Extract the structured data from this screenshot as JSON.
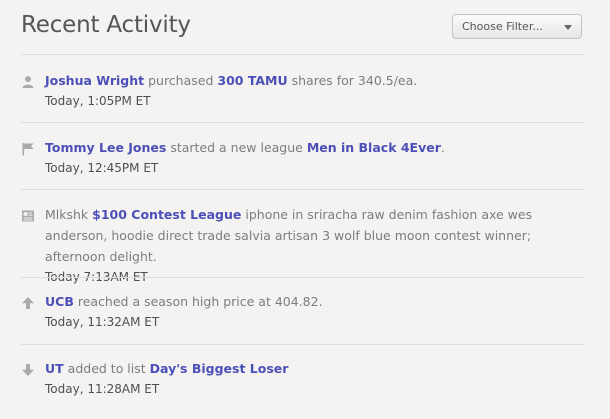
{
  "header": {
    "title": "Recent Activity",
    "filter_label": "Choose Filter..."
  },
  "activities": [
    {
      "icon": "person-icon",
      "link1": "Joshua Wright",
      "text1": " purchased ",
      "link2": "300 TAMU",
      "text2": " shares for 340.5/ea.",
      "time": "Today, 1:05PM ET"
    },
    {
      "icon": "flag-icon",
      "link1": "Tommy Lee Jones",
      "text1": " started a new league ",
      "link2": "Men in Black 4Ever",
      "text2": ".",
      "time": "Today, 12:45PM ET"
    },
    {
      "icon": "news-icon",
      "prefix": "Mlkshk ",
      "link1": "$100 Contest League",
      "text1": " iphone in sriracha raw denim fashion axe wes anderson, hoodie direct trade salvia artisan 3 wolf blue moon contest winner; afternoon delight.",
      "time": "Today 7:13AM ET"
    },
    {
      "icon": "arrow-up-icon",
      "link1": "UCB",
      "text1": " reached a season high price at 404.82.",
      "time": "Today, 11:32AM ET"
    },
    {
      "icon": "arrow-down-icon",
      "link1": "UT",
      "text1": " added to list ",
      "link2": "Day's Biggest Loser",
      "time": "Today, 11:28AM ET"
    }
  ]
}
